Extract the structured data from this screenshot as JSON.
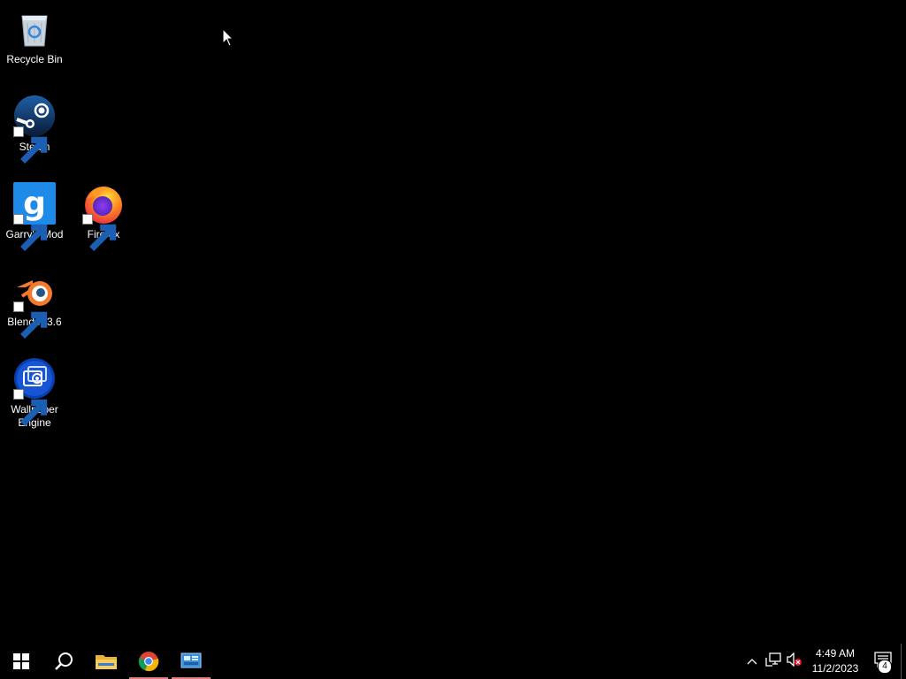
{
  "desktop": {
    "icons": [
      {
        "label": "Recycle Bin",
        "icon": "recycle-bin-icon"
      },
      {
        "label": "Steam",
        "icon": "steam-icon"
      },
      {
        "label": "Garry's Mod",
        "icon": "garrys-mod-icon"
      },
      {
        "label": "Firefox",
        "icon": "firefox-icon"
      },
      {
        "label": "Blender 3.6",
        "icon": "blender-icon"
      },
      {
        "label": "Wallpaper Engine",
        "icon": "wallpaper-engine-icon"
      }
    ]
  },
  "taskbar": {
    "start": {
      "icon": "windows-start-icon"
    },
    "search": {
      "icon": "search-icon"
    },
    "pinned": [
      {
        "icon": "file-explorer-icon",
        "running": false
      },
      {
        "icon": "chrome-icon",
        "running": true
      },
      {
        "icon": "control-panel-icon",
        "running": true
      }
    ],
    "tray": {
      "icons": [
        "chevron-up-icon",
        "network-icon",
        "volume-muted-icon"
      ],
      "time": "4:49 AM",
      "date": "11/2/2023",
      "notification_count": "4"
    }
  },
  "colors": {
    "background": "#000000",
    "taskbar": "#000000",
    "running_indicator": "#e08080"
  }
}
